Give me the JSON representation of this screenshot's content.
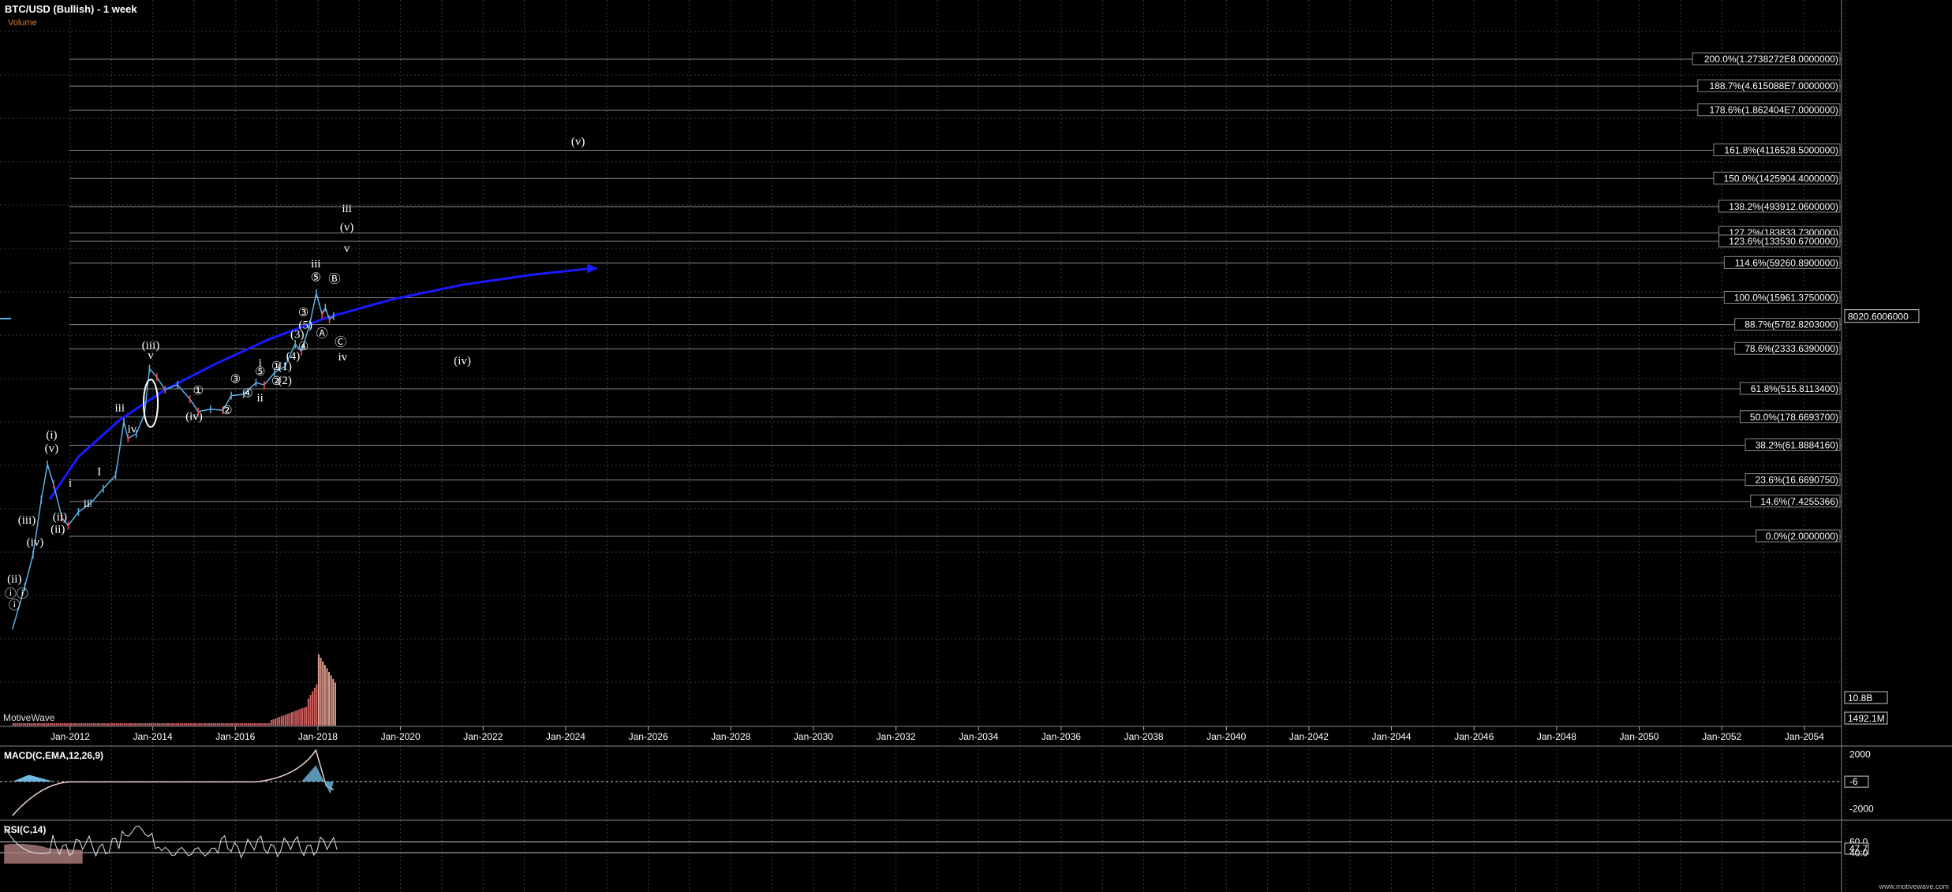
{
  "title": "BTC/USD (Bullish) - 1 week",
  "volume_label": "Volume",
  "watermark": "MotiveWave",
  "footer_url": "www.motivewave.com",
  "colors": {
    "background": "#000000",
    "grid": "#3a3a3a",
    "fib_line": "#8a8a8a",
    "arc": "#1a1aff",
    "volume_label": "#e07a2a",
    "price_up": "#5bb2e8",
    "price_down": "#ff4a4a",
    "macd_pos": "#6fb8e0",
    "macd_neg": "#d8a0a0",
    "rsi_fill": "#b08080"
  },
  "chart_data": {
    "type": "line",
    "x_ticks": [
      "Jan-2012",
      "Jan-2014",
      "Jan-2016",
      "Jan-2018",
      "Jan-2020",
      "Jan-2022",
      "Jan-2024",
      "Jan-2026",
      "Jan-2028",
      "Jan-2030",
      "Jan-2032",
      "Jan-2034",
      "Jan-2036",
      "Jan-2038",
      "Jan-2040",
      "Jan-2042",
      "Jan-2044",
      "Jan-2046",
      "Jan-2048",
      "Jan-2050",
      "Jan-2052",
      "Jan-2054"
    ],
    "xlim": [
      2010.3,
      2054.9
    ],
    "y_scale": "log",
    "current_price_label": "8020.6006000",
    "fib_levels": [
      {
        "label": "200.0%(1.2738272E8.0000000)",
        "value": 127382720
      },
      {
        "label": "188.7%(4.615088E7.0000000)",
        "value": 46150880
      },
      {
        "label": "178.6%(1.862404E7.0000000)",
        "value": 18624040
      },
      {
        "label": "161.8%(4116528.5000000)",
        "value": 4116528.5
      },
      {
        "label": "150.0%(1425904.4000000)",
        "value": 1425904.4
      },
      {
        "label": "138.2%(493912.0600000)",
        "value": 493912.06
      },
      {
        "label": "127.2%(183833.7300000)",
        "value": 183833.73
      },
      {
        "label": "123.6%(133530.6700000)",
        "value": 133530.67
      },
      {
        "label": "114.6%(59260.8900000)",
        "value": 59260.89
      },
      {
        "label": "100.0%(15961.3750000)",
        "value": 15961.375
      },
      {
        "label": "88.7%(5782.8203000)",
        "value": 5782.8203
      },
      {
        "label": "78.6%(2333.6390000)",
        "value": 2333.639
      },
      {
        "label": "61.8%(515.8113400)",
        "value": 515.81134
      },
      {
        "label": "50.0%(178.6693700)",
        "value": 178.66937
      },
      {
        "label": "38.2%(61.8884160)",
        "value": 61.888416
      },
      {
        "label": "23.6%(16.6690750)",
        "value": 16.669075
      },
      {
        "label": "14.6%(7.4255366)",
        "value": 7.4255366
      },
      {
        "label": "0.0%(2.0000000)",
        "value": 2.0
      }
    ],
    "price_series": [
      {
        "x": 2010.6,
        "y": 0.06
      },
      {
        "x": 2010.9,
        "y": 0.3
      },
      {
        "x": 2011.1,
        "y": 1.0
      },
      {
        "x": 2011.3,
        "y": 8
      },
      {
        "x": 2011.45,
        "y": 30
      },
      {
        "x": 2011.6,
        "y": 14
      },
      {
        "x": 2011.8,
        "y": 4
      },
      {
        "x": 2011.95,
        "y": 3
      },
      {
        "x": 2012.2,
        "y": 5
      },
      {
        "x": 2012.5,
        "y": 7
      },
      {
        "x": 2012.8,
        "y": 12
      },
      {
        "x": 2013.1,
        "y": 20
      },
      {
        "x": 2013.3,
        "y": 150
      },
      {
        "x": 2013.4,
        "y": 80
      },
      {
        "x": 2013.6,
        "y": 95
      },
      {
        "x": 2013.8,
        "y": 200
      },
      {
        "x": 2013.92,
        "y": 1100
      },
      {
        "x": 2014.1,
        "y": 800
      },
      {
        "x": 2014.3,
        "y": 500
      },
      {
        "x": 2014.6,
        "y": 600
      },
      {
        "x": 2014.9,
        "y": 350
      },
      {
        "x": 2015.1,
        "y": 220
      },
      {
        "x": 2015.4,
        "y": 240
      },
      {
        "x": 2015.7,
        "y": 230
      },
      {
        "x": 2015.9,
        "y": 400
      },
      {
        "x": 2016.2,
        "y": 420
      },
      {
        "x": 2016.5,
        "y": 650
      },
      {
        "x": 2016.7,
        "y": 600
      },
      {
        "x": 2016.95,
        "y": 950
      },
      {
        "x": 2017.2,
        "y": 1200
      },
      {
        "x": 2017.45,
        "y": 2800
      },
      {
        "x": 2017.6,
        "y": 2100
      },
      {
        "x": 2017.8,
        "y": 5800
      },
      {
        "x": 2017.96,
        "y": 19000
      },
      {
        "x": 2018.1,
        "y": 8500
      },
      {
        "x": 2018.18,
        "y": 11000
      },
      {
        "x": 2018.28,
        "y": 7000
      },
      {
        "x": 2018.38,
        "y": 8020
      }
    ],
    "arc_series": [
      {
        "x": 2011.5,
        "y": 8
      },
      {
        "x": 2012.2,
        "y": 40
      },
      {
        "x": 2013.2,
        "y": 160
      },
      {
        "x": 2014.3,
        "y": 500
      },
      {
        "x": 2015.5,
        "y": 1300
      },
      {
        "x": 2016.8,
        "y": 3300
      },
      {
        "x": 2018.2,
        "y": 7500
      },
      {
        "x": 2019.8,
        "y": 15000
      },
      {
        "x": 2021.5,
        "y": 26000
      },
      {
        "x": 2023.2,
        "y": 38000
      },
      {
        "x": 2024.6,
        "y": 48000
      }
    ],
    "wave_labels": [
      {
        "t": "ⓘ",
        "x": 2010.65,
        "y": 0.13
      },
      {
        "t": "ⓘⓘ",
        "x": 2010.7,
        "y": 0.2
      },
      {
        "t": "(ii)",
        "x": 2010.65,
        "y": 0.35
      },
      {
        "t": "(iii)",
        "x": 2010.95,
        "y": 3.2
      },
      {
        "t": "(iv)",
        "x": 2011.15,
        "y": 1.4
      },
      {
        "t": "(v)",
        "x": 2011.55,
        "y": 48
      },
      {
        "t": "(i)",
        "x": 2011.55,
        "y": 80
      },
      {
        "t": "(ii)",
        "x": 2011.7,
        "y": 2.3
      },
      {
        "t": "(ii)",
        "x": 2011.75,
        "y": 3.6
      },
      {
        "t": "i",
        "x": 2012.0,
        "y": 13
      },
      {
        "t": "ii",
        "x": 2012.4,
        "y": 6
      },
      {
        "t": "I",
        "x": 2012.7,
        "y": 20
      },
      {
        "t": "iii",
        "x": 2013.2,
        "y": 220
      },
      {
        "t": "iv",
        "x": 2013.5,
        "y": 100
      },
      {
        "t": "(iii)",
        "x": 2013.95,
        "y": 2300
      },
      {
        "t": "v",
        "x": 2013.95,
        "y": 1600
      },
      {
        "t": "(iv)",
        "x": 2015.0,
        "y": 160
      },
      {
        "t": "①",
        "x": 2015.1,
        "y": 420
      },
      {
        "t": "②",
        "x": 2015.8,
        "y": 200
      },
      {
        "t": "③",
        "x": 2016.0,
        "y": 650
      },
      {
        "t": "④",
        "x": 2016.3,
        "y": 380
      },
      {
        "t": "ii",
        "x": 2016.6,
        "y": 320
      },
      {
        "t": "⑤",
        "x": 2016.6,
        "y": 850
      },
      {
        "t": "i",
        "x": 2016.6,
        "y": 1200
      },
      {
        "t": "①",
        "x": 2017.0,
        "y": 1050
      },
      {
        "t": "②",
        "x": 2017.0,
        "y": 600
      },
      {
        "t": "(1)",
        "x": 2017.2,
        "y": 1050
      },
      {
        "t": "(2)",
        "x": 2017.2,
        "y": 620
      },
      {
        "t": "(4)",
        "x": 2017.4,
        "y": 1550
      },
      {
        "t": "(3)",
        "x": 2017.5,
        "y": 3500
      },
      {
        "t": "(5)",
        "x": 2017.7,
        "y": 5000
      },
      {
        "t": "③",
        "x": 2017.65,
        "y": 8000
      },
      {
        "t": "④",
        "x": 2017.65,
        "y": 2200
      },
      {
        "t": "Ⓐ",
        "x": 2018.1,
        "y": 3600
      },
      {
        "t": "⑤",
        "x": 2017.95,
        "y": 30000
      },
      {
        "t": "Ⓑ",
        "x": 2018.4,
        "y": 28000
      },
      {
        "t": "iii",
        "x": 2017.95,
        "y": 50000
      },
      {
        "t": "Ⓒ",
        "x": 2018.55,
        "y": 2600
      },
      {
        "t": "iv",
        "x": 2018.6,
        "y": 1500
      },
      {
        "t": "v",
        "x": 2018.7,
        "y": 90000
      },
      {
        "t": "(v)",
        "x": 2018.7,
        "y": 200000
      },
      {
        "t": "iii",
        "x": 2018.7,
        "y": 400000
      },
      {
        "t": "(iv)",
        "x": 2021.5,
        "y": 1300
      },
      {
        "t": "(v)",
        "x": 2024.3,
        "y": 5000000
      }
    ],
    "volume_axis_labels": [
      "10.8B",
      "1492.1M"
    ],
    "macd": {
      "title": "MACD(C,EMA,12,26,9)",
      "axis_labels": [
        "2000",
        "-6",
        "-2000"
      ],
      "ylim": [
        -2600,
        2600
      ]
    },
    "rsi": {
      "title": "RSI(C,14)",
      "axis_labels": [
        "60.0",
        "47.7",
        "40.0"
      ],
      "ylim": [
        20,
        100
      ]
    }
  }
}
